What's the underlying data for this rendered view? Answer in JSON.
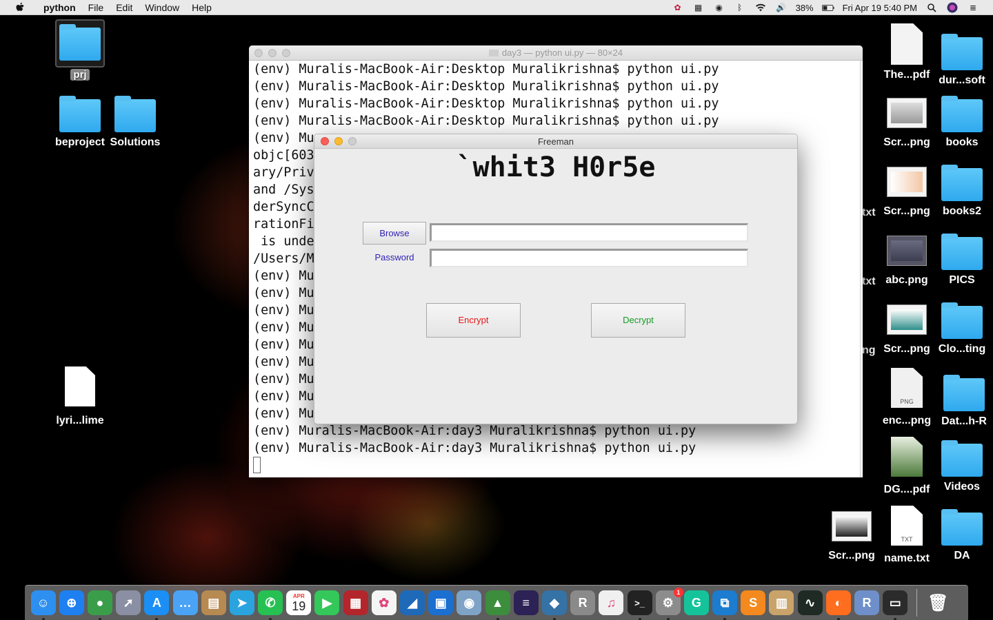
{
  "menubar": {
    "app_name": "python",
    "items": [
      "File",
      "Edit",
      "Window",
      "Help"
    ],
    "battery": "38%",
    "clock": "Fri Apr 19  5:40 PM"
  },
  "desktop": {
    "left_icons": [
      {
        "label": "prj",
        "kind": "folder",
        "selected": true
      },
      {
        "label": "beproject",
        "kind": "folder"
      },
      {
        "label": "Solutions",
        "kind": "folder"
      },
      {
        "label": "lyri...lime",
        "kind": "file"
      }
    ],
    "right_icons": [
      {
        "label": "The...pdf",
        "kind": "doc-thumb"
      },
      {
        "label": "dur...soft",
        "kind": "folder"
      },
      {
        "label": "Scr...png",
        "kind": "thumb"
      },
      {
        "label": "books",
        "kind": "folder"
      },
      {
        "label": "Scr...png",
        "kind": "thumb"
      },
      {
        "label": "books2",
        "kind": "folder"
      },
      {
        "label": "abc.png",
        "kind": "thumb"
      },
      {
        "label": "PICS",
        "kind": "folder"
      },
      {
        "label": "Scr...png",
        "kind": "thumb"
      },
      {
        "label": "Clo...ting",
        "kind": "folder"
      },
      {
        "label": "enc...png",
        "kind": "png-file"
      },
      {
        "label": "Dat...h-R",
        "kind": "folder"
      },
      {
        "label": "DG....pdf",
        "kind": "doc-thumb"
      },
      {
        "label": "Videos",
        "kind": "folder"
      },
      {
        "label": "Scr...png",
        "kind": "thumb"
      },
      {
        "label": "name.txt",
        "kind": "txt-file"
      },
      {
        "label": "DA",
        "kind": "folder"
      }
    ],
    "partial_labels": [
      "txt",
      "txt",
      "ng"
    ],
    "png_badge": "PNG",
    "txt_badge": "TXT"
  },
  "terminal": {
    "title": "day3 — python ui.py — 80×24",
    "lines": [
      "(env) Muralis-MacBook-Air:Desktop Muralikrishna$ python ui.py",
      "(env) Muralis-MacBook-Air:Desktop Muralikrishna$ python ui.py",
      "(env) Muralis-MacBook-Air:Desktop Muralikrishna$ python ui.py",
      "(env) Muralis-MacBook-Air:Desktop Muralikrishna$ python ui.py",
      "(env) Mu                                                    ",
      "objc[603                                                      tem/Libr",
      "ary/Priv                                                      3dc3c8)",
      "and /Sys                                                      dles/Fin",
      "derSyncC                                                      cCollabo",
      "rationFi                                                      hich one",
      " is unde",
      "/Users/M",
      "(env) Mu",
      "(env) Mu",
      "(env) Mu",
      "(env) Mu",
      "(env) Mu",
      "(env) Mu",
      "(env) Mu",
      "(env) Mu",
      "(env) Mu",
      "(env) Muralis-MacBook-Air:day3 Muralikrishna$ python ui.py",
      "(env) Muralis-MacBook-Air:day3 Muralikrishna$ python ui.py"
    ]
  },
  "dialog": {
    "title": "Freeman",
    "heading": "`whit3 H0r5e",
    "browse_label": "Browse",
    "password_label": "Password",
    "file_value": "",
    "password_value": "",
    "encrypt_label": "Encrypt",
    "decrypt_label": "Decrypt",
    "encrypt_color": "#e3151a",
    "decrypt_color": "#159a24",
    "label_color": "#2c1fb4"
  },
  "dock": {
    "calendar_month": "APR",
    "calendar_day": "19",
    "badge_count": "1",
    "apps": [
      {
        "name": "finder-icon",
        "color": "#2d8ff0",
        "glyph": "☺"
      },
      {
        "name": "safari-icon",
        "color": "#1e7ff0",
        "glyph": "⊕"
      },
      {
        "name": "chrome-icon",
        "color": "#3a9d4a",
        "glyph": "●"
      },
      {
        "name": "launchpad-icon",
        "color": "#8a8fa3",
        "glyph": "➚"
      },
      {
        "name": "app-store-icon",
        "color": "#1b8ff5",
        "glyph": "A"
      },
      {
        "name": "messenger-icon",
        "color": "#4aa3f5",
        "glyph": "…"
      },
      {
        "name": "notes-icon",
        "color": "#b78a52",
        "glyph": "▤"
      },
      {
        "name": "telegram-icon",
        "color": "#2aa4df",
        "glyph": "➤"
      },
      {
        "name": "whatsapp-icon",
        "color": "#27c052",
        "glyph": "✆"
      },
      {
        "name": "calendar-icon",
        "color": "#ffffff",
        "glyph": ""
      },
      {
        "name": "facetime-icon",
        "color": "#34c759",
        "glyph": "▶"
      },
      {
        "name": "photo-booth-icon",
        "color": "#b3262b",
        "glyph": "▦"
      },
      {
        "name": "photos-icon",
        "color": "#f4f4f4",
        "glyph": "✿"
      },
      {
        "name": "wireshark-icon",
        "color": "#1e69b8",
        "glyph": "◢"
      },
      {
        "name": "pdf-tool-icon",
        "color": "#1b6fd1",
        "glyph": "▣"
      },
      {
        "name": "preview-eye-icon",
        "color": "#7fa3c6",
        "glyph": "◉"
      },
      {
        "name": "android-studio-icon",
        "color": "#3c8d3c",
        "glyph": "▲"
      },
      {
        "name": "eclipse-icon",
        "color": "#2c2255",
        "glyph": "≡"
      },
      {
        "name": "python-icon",
        "color": "#3572a5",
        "glyph": "◆"
      },
      {
        "name": "r-studio-icon",
        "color": "#8a8a8a",
        "glyph": "R"
      },
      {
        "name": "music-icon",
        "color": "#f0f0f0",
        "glyph": "♫"
      },
      {
        "name": "terminal-icon",
        "color": "#222222",
        "glyph": ">_"
      },
      {
        "name": "system-preferences-icon",
        "color": "#8c8c8c",
        "glyph": "⚙"
      },
      {
        "name": "grammarly-icon",
        "color": "#15c39a",
        "glyph": "G"
      },
      {
        "name": "vscode-icon",
        "color": "#1c7ccf",
        "glyph": "⧉"
      },
      {
        "name": "sublime-icon",
        "color": "#f4891f",
        "glyph": "S"
      },
      {
        "name": "archive-icon",
        "color": "#c9a36a",
        "glyph": "▥"
      },
      {
        "name": "activity-monitor-icon",
        "color": "#1f2a24",
        "glyph": "∿"
      },
      {
        "name": "firefox-icon",
        "color": "#ff6d1f",
        "glyph": "◐"
      },
      {
        "name": "r-icon",
        "color": "#6e8fc9",
        "glyph": "R"
      },
      {
        "name": "console-icon",
        "color": "#2b2b2b",
        "glyph": "▭"
      }
    ],
    "trash": {
      "name": "trash-icon",
      "glyph": "🗑"
    }
  }
}
